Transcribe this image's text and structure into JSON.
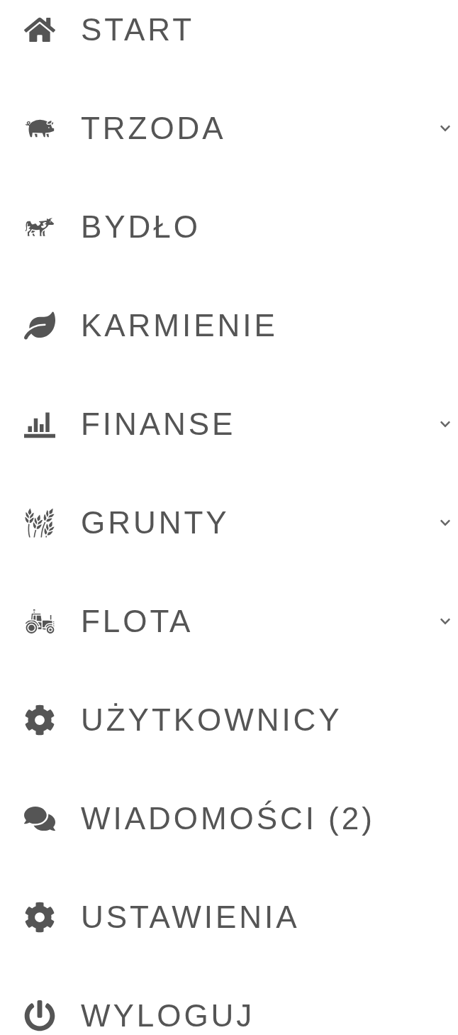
{
  "menu": {
    "items": [
      {
        "label": "START",
        "expandable": false
      },
      {
        "label": "TRZODA",
        "expandable": true
      },
      {
        "label": "BYDŁO",
        "expandable": false
      },
      {
        "label": "KARMIENIE",
        "expandable": false
      },
      {
        "label": "FINANSE",
        "expandable": true
      },
      {
        "label": "GRUNTY",
        "expandable": true
      },
      {
        "label": "FLOTA",
        "expandable": true
      },
      {
        "label": "UŻYTKOWNICY",
        "expandable": false
      },
      {
        "label": "WIADOMOŚCI (2)",
        "expandable": false
      },
      {
        "label": "USTAWIENIA",
        "expandable": false
      },
      {
        "label": "WYLOGUJ",
        "expandable": false
      }
    ]
  }
}
